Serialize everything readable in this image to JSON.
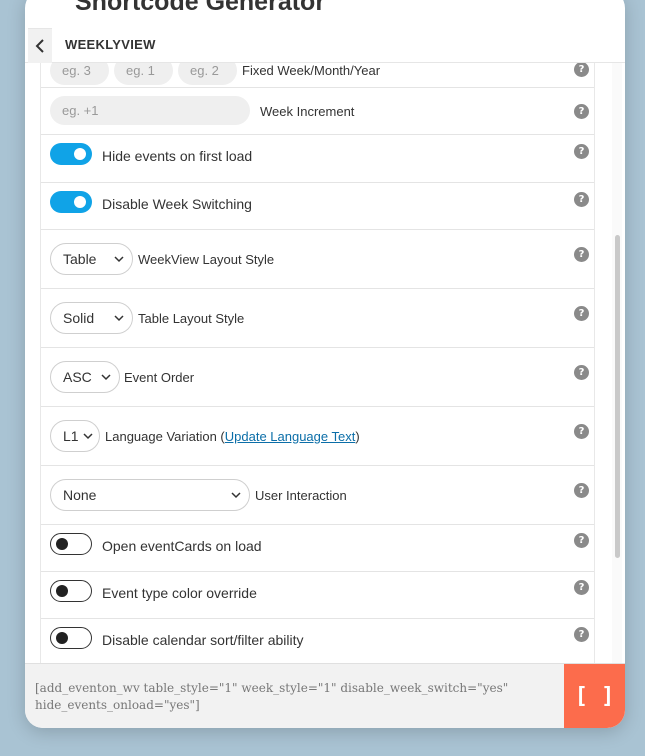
{
  "modal": {
    "title": "Shortcode Generator",
    "subheader_title": "WEEKLYVIEW"
  },
  "rows": {
    "fixed": {
      "placeholders": [
        "eg. 3",
        "eg. 1",
        "eg. 2"
      ],
      "label": "Fixed Week/Month/Year"
    },
    "increment": {
      "placeholder": "eg. +1",
      "label": "Week Increment"
    },
    "hide_events": {
      "label": "Hide events on first load",
      "state": "on"
    },
    "disable_switch": {
      "label": "Disable Week Switching",
      "state": "on"
    },
    "layout_style": {
      "value": "Table",
      "label": "WeekView Layout Style"
    },
    "table_style": {
      "value": "Solid",
      "label": "Table Layout Style"
    },
    "event_order": {
      "value": "ASC",
      "label": "Event Order"
    },
    "language": {
      "value": "L1",
      "label_prefix": "Language Variation (",
      "link": "Update Language Text",
      "label_suffix": ")"
    },
    "user_interaction": {
      "value": "None",
      "label": "User Interaction"
    },
    "open_eventcards": {
      "label": "Open eventCards on load",
      "state": "off"
    },
    "color_override": {
      "label": "Event type color override",
      "state": "off"
    },
    "disable_sort": {
      "label": "Disable calendar sort/filter ability",
      "state": "off"
    },
    "help_glyph": "?"
  },
  "footer": {
    "shortcode": "[add_eventon_wv table_style=\"1\" week_style=\"1\" disable_week_switch=\"yes\" hide_events_onload=\"yes\"]",
    "copy_label": "[ ]"
  },
  "colors": {
    "accent": "#10a3e7",
    "copy_button": "#fc6c4c",
    "link": "#0b6ea8"
  }
}
